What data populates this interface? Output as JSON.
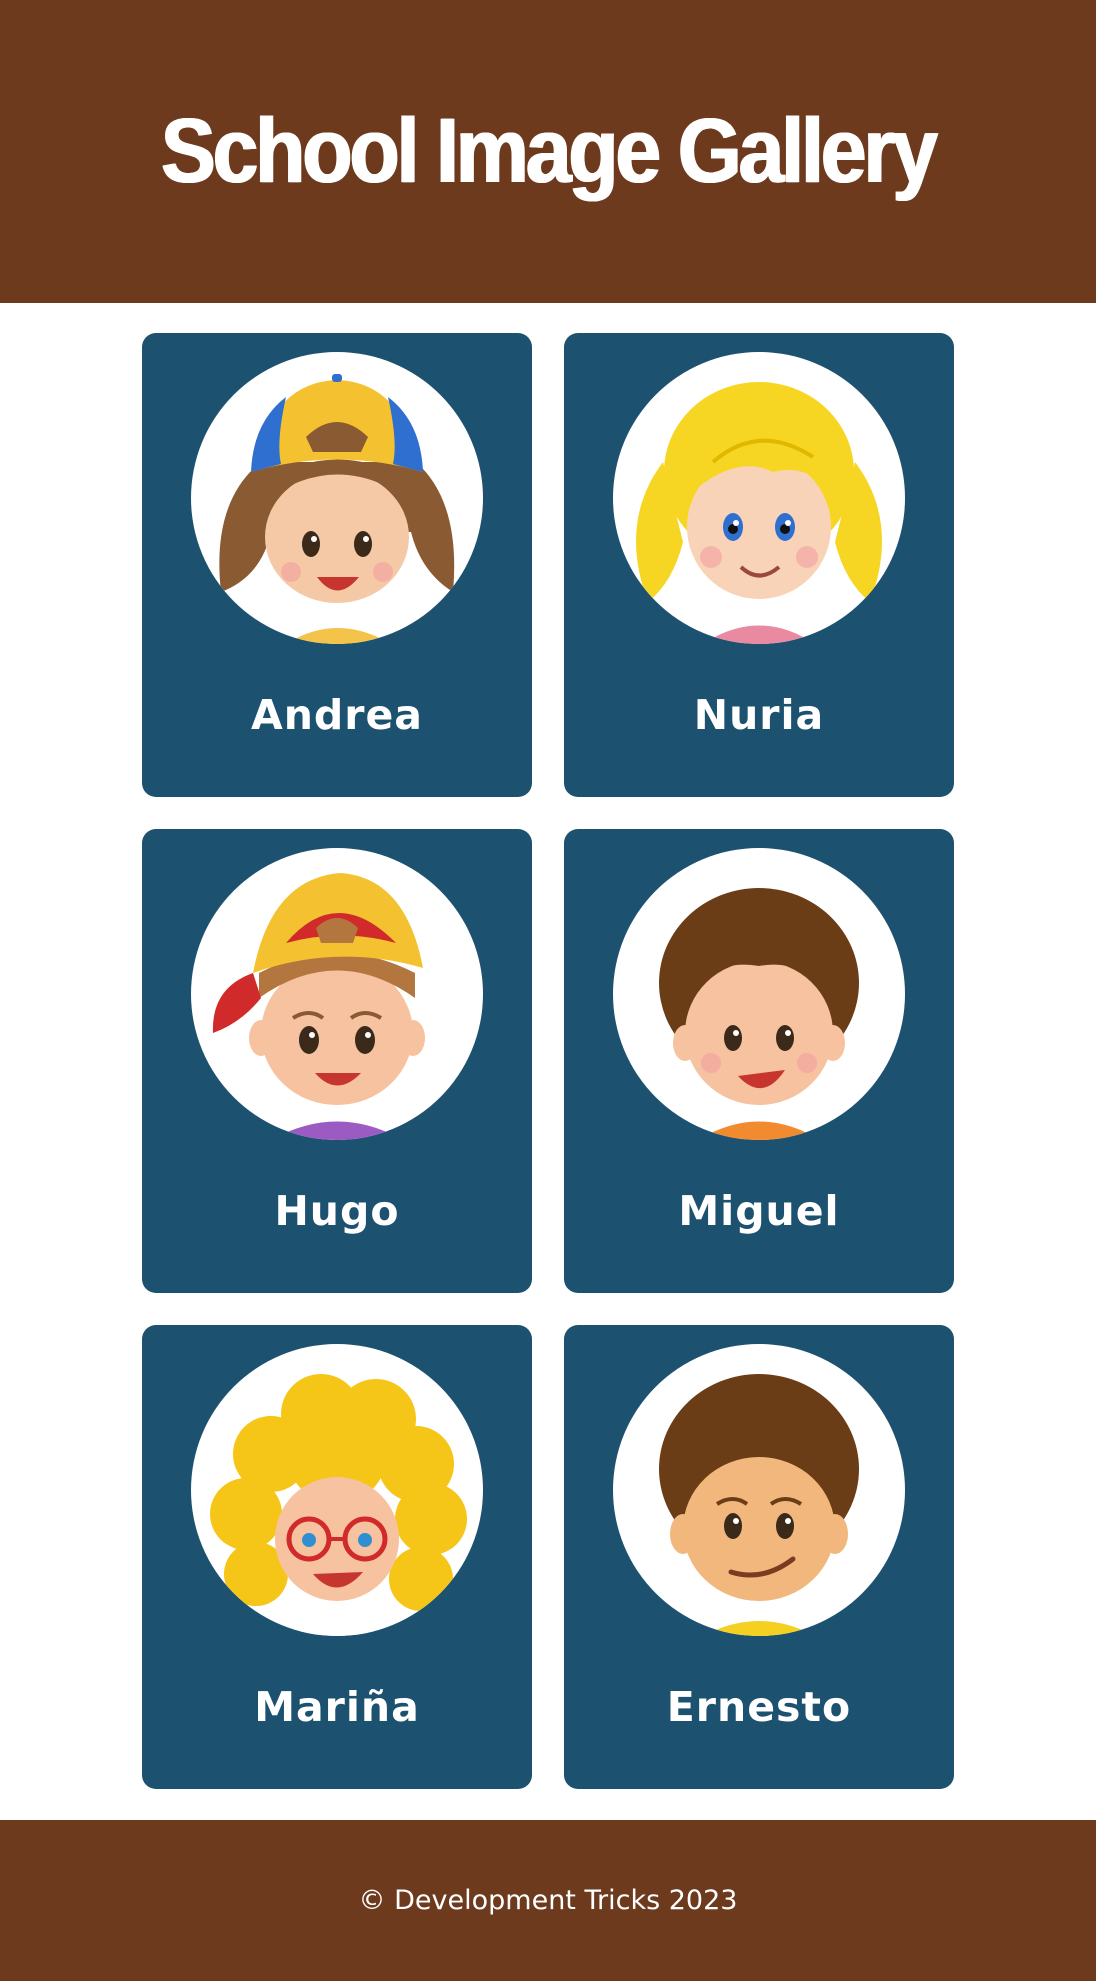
{
  "header": {
    "title": "School Image Gallery"
  },
  "gallery": {
    "students": [
      {
        "name": "Andrea",
        "avatar": "girl-with-blue-cap-icon"
      },
      {
        "name": "Nuria",
        "avatar": "girl-blonde-pigtails-icon"
      },
      {
        "name": "Hugo",
        "avatar": "boy-with-red-cap-icon"
      },
      {
        "name": "Miguel",
        "avatar": "boy-brown-hair-icon"
      },
      {
        "name": "Mariña",
        "avatar": "girl-curly-hair-glasses-icon"
      },
      {
        "name": "Ernesto",
        "avatar": "boy-smirking-icon"
      }
    ]
  },
  "footer": {
    "copyright": "© Development Tricks 2023"
  },
  "colors": {
    "header_bg": "#6d3a1e",
    "card_bg": "#1d5170",
    "text": "#ffffff"
  }
}
